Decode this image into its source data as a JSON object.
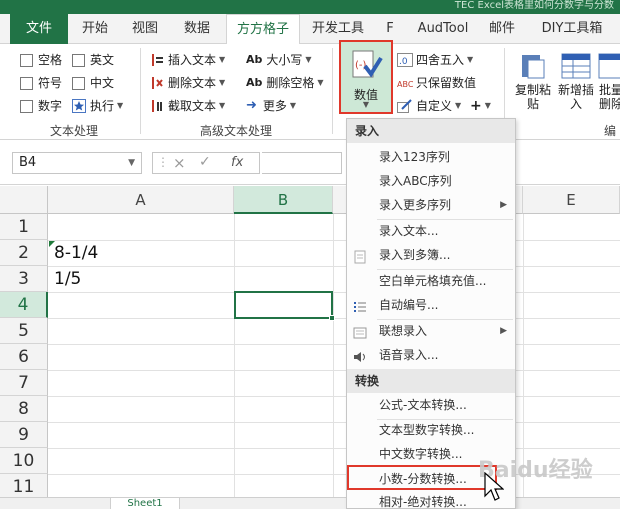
{
  "window": {
    "title": "TEC Excel表格里如何分数字与分数"
  },
  "tabs": [
    {
      "label": "文件"
    },
    {
      "label": "开始"
    },
    {
      "label": "视图"
    },
    {
      "label": "数据"
    },
    {
      "label": "方方格子"
    },
    {
      "label": "开发工具"
    },
    {
      "label": "F"
    },
    {
      "label": "AudTool"
    },
    {
      "label": "邮件"
    },
    {
      "label": "DIY工具箱"
    }
  ],
  "ribbon": {
    "text_processing": {
      "checks": [
        "空格",
        "英文",
        "符号",
        "中文",
        "数字",
        "执行"
      ],
      "group_label": "文本处理"
    },
    "advanced_text": {
      "items": [
        "插入文本",
        "大小写",
        "删除文本",
        "删除空格",
        "截取文本",
        "更多"
      ],
      "group_label": "高级文本处理"
    },
    "numeric": {
      "value_button": "数值",
      "round": "四舍五入",
      "keep_values": "只保留数值",
      "custom": "自定义",
      "plus": "+"
    },
    "edit": {
      "copy_paste": "复制粘贴",
      "insert_new": "新增插入",
      "batch_delete": "批量删除",
      "group_label": "编"
    }
  },
  "formula_bar": {
    "name_box": "B4",
    "fx": "fx",
    "cancel": "×",
    "confirm": "✓"
  },
  "grid": {
    "columns": [
      "A",
      "B",
      "C",
      "D",
      "E"
    ],
    "rows": [
      "1",
      "2",
      "3",
      "4",
      "5",
      "6",
      "7",
      "8",
      "9",
      "10",
      "11"
    ],
    "cells": {
      "A2": "8-1/4",
      "A3": "1/5"
    },
    "selected_cell": "B4"
  },
  "sheet_tab": "Sheet1",
  "menu": {
    "section1": "录入",
    "items1": [
      "录入123序列",
      "录入ABC序列",
      "录入更多序列",
      "录入文本...",
      "录入到多簿...",
      "空白单元格填充值...",
      "自动编号...",
      "联想录入",
      "语音录入..."
    ],
    "section2": "转换",
    "items2": [
      "公式-文本转换...",
      "文本型数字转换...",
      "中文数字转换...",
      "小数-分数转换...",
      "相对-绝对转换..."
    ]
  },
  "watermark": "Baidu经验"
}
